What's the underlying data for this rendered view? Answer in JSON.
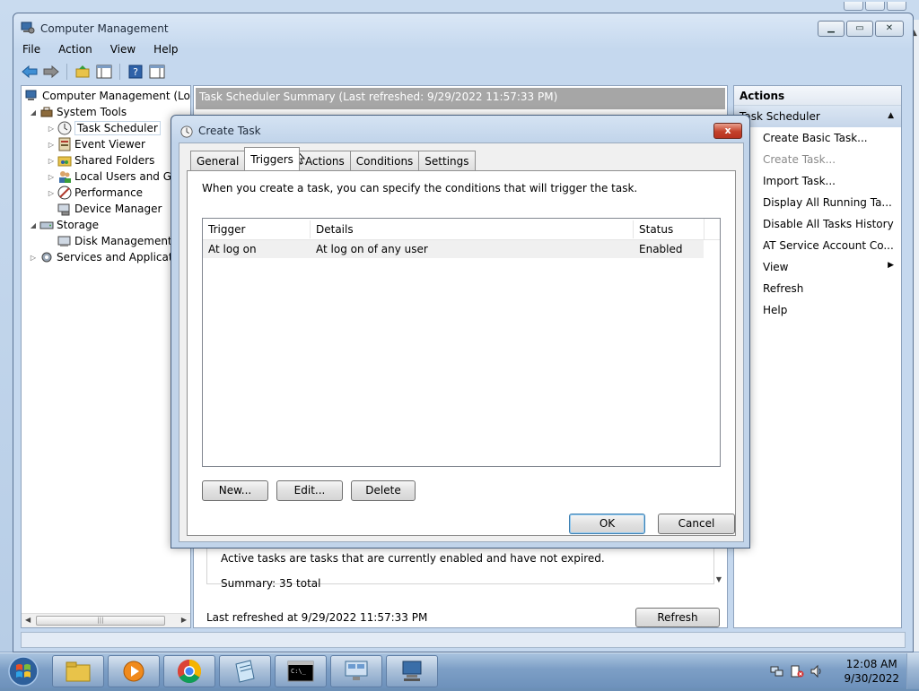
{
  "window": {
    "title": "Computer Management",
    "menu": [
      "File",
      "Action",
      "View",
      "Help"
    ]
  },
  "tree": {
    "items": [
      {
        "label": "Computer Management (Local",
        "level": 0,
        "expander": ""
      },
      {
        "label": "System Tools",
        "level": 1,
        "expander": "◢"
      },
      {
        "label": "Task Scheduler",
        "level": 2,
        "expander": "▷",
        "selected": true
      },
      {
        "label": "Event Viewer",
        "level": 2,
        "expander": "▷"
      },
      {
        "label": "Shared Folders",
        "level": 2,
        "expander": "▷"
      },
      {
        "label": "Local Users and Gro",
        "level": 2,
        "expander": "▷"
      },
      {
        "label": "Performance",
        "level": 2,
        "expander": "▷"
      },
      {
        "label": "Device Manager",
        "level": 2,
        "expander": ""
      },
      {
        "label": "Storage",
        "level": 1,
        "expander": "◢"
      },
      {
        "label": "Disk Management",
        "level": 2,
        "expander": ""
      },
      {
        "label": "Services and Application",
        "level": 1,
        "expander": "▷"
      }
    ]
  },
  "center": {
    "header": "Task Scheduler Summary (Last refreshed: 9/29/2022 11:57:33 PM)",
    "active_text": "Active tasks are tasks that are currently enabled and have not expired.",
    "summary": "Summary: 35 total",
    "last_refreshed": "Last refreshed at 9/29/2022 11:57:33 PM",
    "refresh_button": "Refresh"
  },
  "actions": {
    "header": "Actions",
    "section": "Task Scheduler",
    "items": [
      {
        "label": "Create Basic Task...",
        "enabled": true
      },
      {
        "label": "Create Task...",
        "enabled": false
      },
      {
        "label": "Import Task...",
        "enabled": true
      },
      {
        "label": "Display All Running Ta...",
        "enabled": true
      },
      {
        "label": "Disable All Tasks History",
        "enabled": true
      },
      {
        "label": "AT Service Account Co...",
        "enabled": true
      },
      {
        "label": "View",
        "enabled": true,
        "submenu": true
      },
      {
        "label": "Refresh",
        "enabled": true
      },
      {
        "label": "Help",
        "enabled": true
      }
    ]
  },
  "dialog": {
    "title": "Create Task",
    "close": "x",
    "tabs": [
      "General",
      "Triggers",
      "Actions",
      "Conditions",
      "Settings"
    ],
    "active_tab": "Triggers",
    "description": "When you create a task, you can specify the conditions that will trigger the task.",
    "columns": [
      "Trigger",
      "Details",
      "Status"
    ],
    "rows": [
      {
        "trigger": "At log on",
        "details": "At log on of any user",
        "status": "Enabled"
      }
    ],
    "buttons": {
      "new": "New...",
      "edit": "Edit...",
      "delete": "Delete",
      "ok": "OK",
      "cancel": "Cancel"
    }
  },
  "taskbar": {
    "time": "12:08 AM",
    "date": "9/30/2022",
    "apps": [
      "windows-explorer",
      "media-player",
      "chrome",
      "notepad",
      "command-prompt",
      "network-app",
      "computer-management"
    ]
  }
}
